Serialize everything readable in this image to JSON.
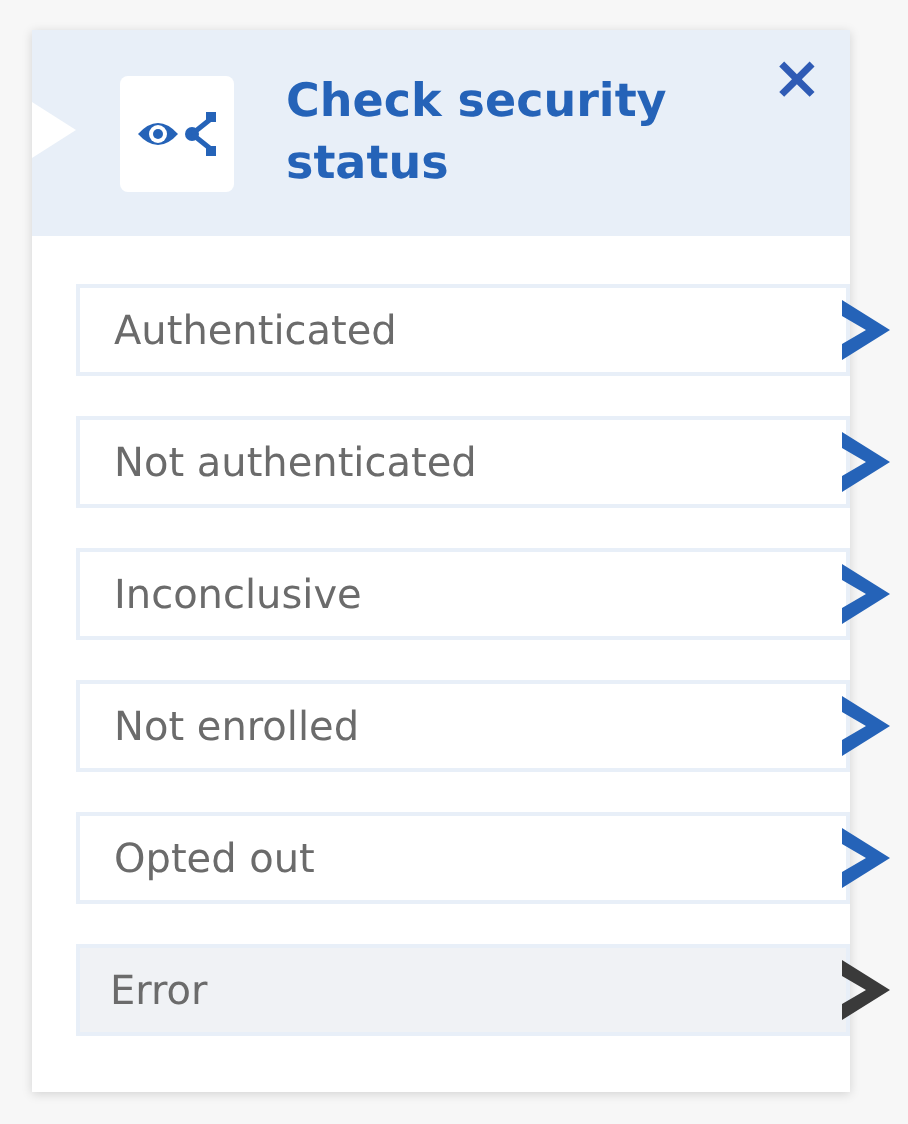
{
  "block": {
    "title": "Check security status",
    "close": "×"
  },
  "branches": [
    {
      "label": "Authenticated",
      "kind": "branch"
    },
    {
      "label": "Not authenticated",
      "kind": "branch"
    },
    {
      "label": "Inconclusive",
      "kind": "branch"
    },
    {
      "label": "Not enrolled",
      "kind": "branch"
    },
    {
      "label": "Opted out",
      "kind": "branch"
    },
    {
      "label": "Error",
      "kind": "error"
    }
  ]
}
